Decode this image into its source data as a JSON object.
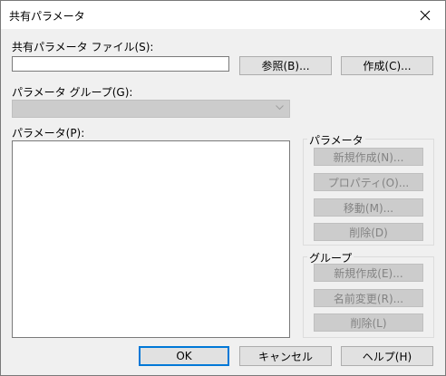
{
  "window": {
    "title": "共有パラメータ",
    "close_glyph": "✕"
  },
  "shared_file": {
    "label": "共有パラメータ ファイル(S):",
    "value": "",
    "browse_label": "参照(B)...",
    "create_label": "作成(C)..."
  },
  "group_select": {
    "label": "パラメータ グループ(G):",
    "value": ""
  },
  "parameters_list": {
    "label": "パラメータ(P):",
    "items": []
  },
  "parameters_group": {
    "title": "パラメータ",
    "buttons": {
      "new": "新規作成(N)...",
      "properties": "プロパティ(O)...",
      "move": "移動(M)...",
      "delete": "削除(D)"
    }
  },
  "groups_group": {
    "title": "グループ",
    "buttons": {
      "new": "新規作成(E)...",
      "rename": "名前変更(R)...",
      "delete": "削除(L)"
    }
  },
  "footer": {
    "ok": "OK",
    "cancel": "キャンセル",
    "help": "ヘルプ(H)"
  }
}
